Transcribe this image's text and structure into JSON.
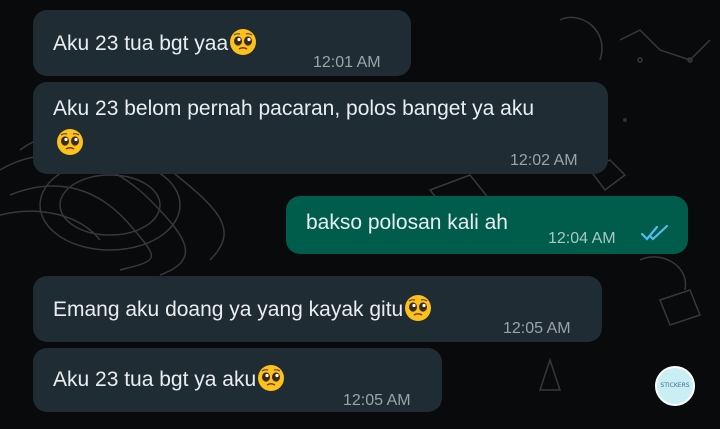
{
  "messages": [
    {
      "id": "m1",
      "direction": "incoming",
      "text": "Aku 23 tua bgt yaa",
      "emoji": "pleading-face-emoji",
      "time": "12:01 AM"
    },
    {
      "id": "m2",
      "direction": "incoming",
      "text": "Aku 23 belom pernah pacaran, polos banget ya aku",
      "emoji": "pleading-face-emoji",
      "time": "12:02 AM"
    },
    {
      "id": "m3",
      "direction": "outgoing",
      "text": "bakso polosan kali ah",
      "time": "12:04 AM",
      "status": "read",
      "status_icon": "double-check-icon"
    },
    {
      "id": "m4",
      "direction": "incoming",
      "text": "Emang aku doang ya yang kayak gitu",
      "emoji": "pleading-face-emoji",
      "time": "12:05 AM"
    },
    {
      "id": "m5",
      "direction": "incoming",
      "text": "Aku 23 tua bgt ya aku",
      "emoji": "pleading-face-emoji",
      "time": "12:05 AM"
    }
  ],
  "sticker_badge": {
    "label": "STICKERS",
    "icon": "sticker-badge-icon"
  },
  "colors": {
    "incoming_bubble": "#1f2c33",
    "outgoing_bubble": "#005c4b",
    "read_ticks": "#53bdeb",
    "background": "#080a0b"
  }
}
